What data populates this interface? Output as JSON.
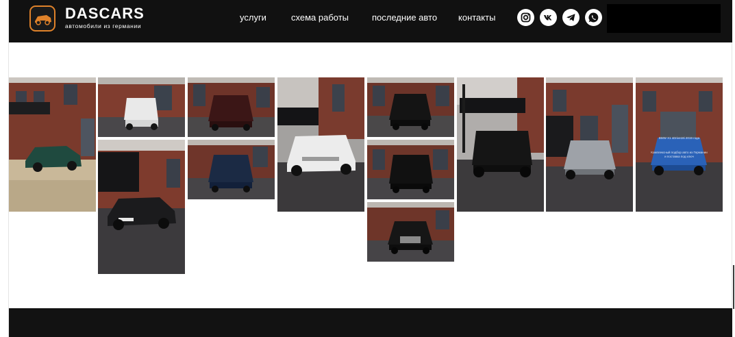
{
  "header": {
    "logo": {
      "title": "DASCARS",
      "subtitle": "автомобили из германии"
    },
    "nav": [
      {
        "label": "услуги"
      },
      {
        "label": "схема работы"
      },
      {
        "label": "последние авто"
      },
      {
        "label": "контакты"
      }
    ],
    "social_icons": [
      "instagram-icon",
      "vk-icon",
      "telegram-icon",
      "whatsapp-icon"
    ]
  },
  "gallery": {
    "tile_overlay": {
      "line1": "BMW X1 sDrive18i 2019 года",
      "line2": "Комплексный подбор авто из Германии",
      "line3": "и поставка под ключ"
    }
  },
  "colors": {
    "header_bg": "#111111",
    "logo_accent": "#e0822a",
    "footer_bg": "#121212"
  }
}
